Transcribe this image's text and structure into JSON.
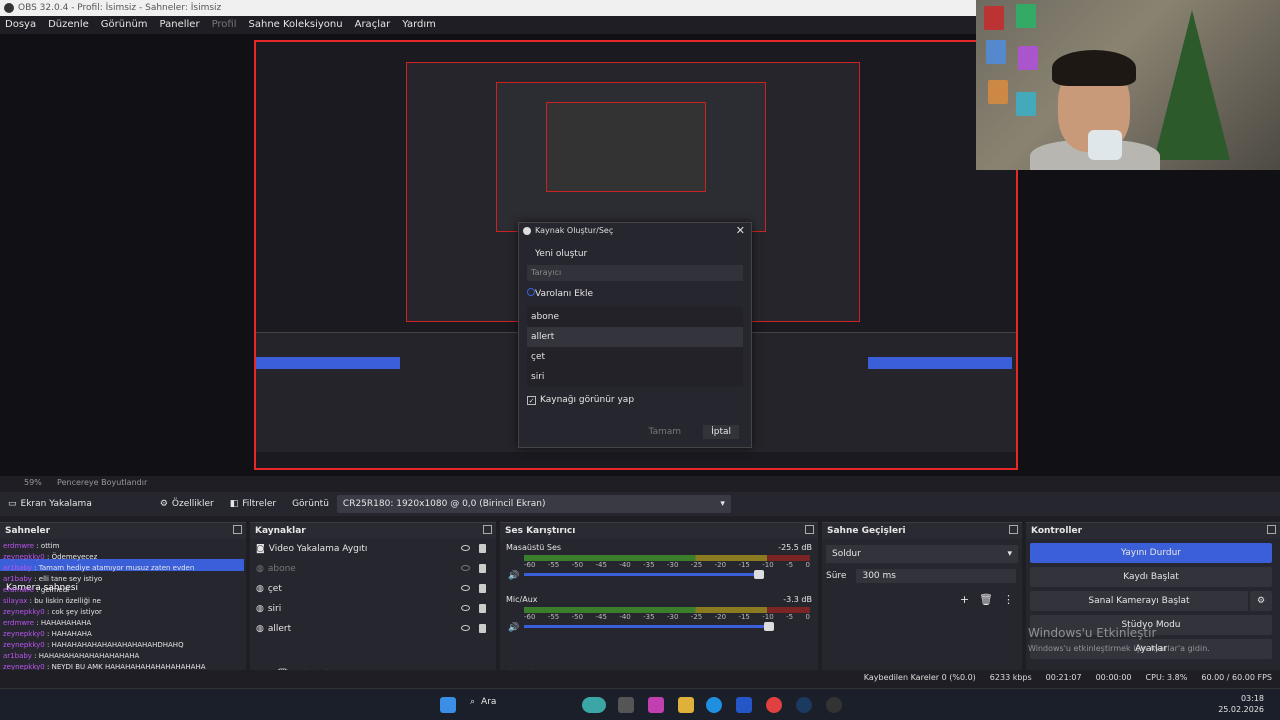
{
  "window": {
    "title": "OBS 32.0.4 - Profil: İsimsiz - Sahneler: İsimsiz"
  },
  "menu": [
    "Dosya",
    "Düzenle",
    "Görünüm",
    "Paneller",
    "Profil",
    "Sahne Koleksiyonu",
    "Araçlar",
    "Yardım"
  ],
  "zoom": {
    "value": "59%",
    "label": "Pencereye Boyutlandır"
  },
  "source_toolbar": {
    "source": "Ekran Yakalama",
    "properties": "Özellikler",
    "filters": "Filtreler",
    "display_label": "Görüntü",
    "display_value": "CR25R180: 1920x1080 @ 0,0 (Birincil Ekran)"
  },
  "dialog": {
    "title": "Kaynak Oluştur/Seç",
    "create_new": "Yeni oluştur",
    "name_placeholder": "Tarayıcı",
    "add_existing": "Varolanı Ekle",
    "existing": [
      "abone",
      "allert",
      "çet",
      "siri"
    ],
    "visible_label": "Kaynağı görünür yap",
    "ok": "Tamam",
    "cancel": "İptal"
  },
  "scenes": {
    "title": "Sahneler",
    "overlay_label": "Kamera sahnesi",
    "chat": [
      {
        "user": "erdmwre",
        "msg": "ottim"
      },
      {
        "user": "zeynepkky0",
        "msg": "Ödemeyecez"
      },
      {
        "user": "ar1baby",
        "msg": "Tamam hediye atamıyor musuz zaten evden"
      },
      {
        "user": "ar1baby",
        "msg": "elli tane sey istiyo"
      },
      {
        "user": "erdmwre",
        "msg": "gelmedi"
      },
      {
        "user": "silayax",
        "msg": "bu liskin özelliği ne"
      },
      {
        "user": "zeynepkky0",
        "msg": "cok şey istiyor"
      },
      {
        "user": "erdmwre",
        "msg": "HAHAHAHAHA"
      },
      {
        "user": "zeynepkky0",
        "msg": "HAHAHAHA"
      },
      {
        "user": "zeynepkky0",
        "msg": "HAHAHAHAHAHAHAHAHAHAHDHAHQ"
      },
      {
        "user": "ar1baby",
        "msg": "HAHAHAHAHAHAHAHAHAHA"
      },
      {
        "user": "zeynepkky0",
        "msg": "NEYDI BU AMK HAHAHAHAHAHAHAHAHAHA"
      }
    ]
  },
  "sources": {
    "title": "Kaynaklar",
    "items": [
      "Video Yakalama Aygıtı",
      "abone",
      "çet",
      "siri",
      "allert"
    ]
  },
  "mixer": {
    "title": "Ses Karıştırıcı",
    "channels": [
      {
        "name": "Masaüstü Ses",
        "db": "-25.5 dB"
      },
      {
        "name": "Mic/Aux",
        "db": "-3.3 dB"
      }
    ],
    "scale": [
      "-60",
      "-55",
      "-50",
      "-45",
      "-40",
      "-35",
      "-30",
      "-25",
      "-20",
      "-15",
      "-10",
      "-5",
      "0"
    ]
  },
  "transitions": {
    "title": "Sahne Geçişleri",
    "type": "Soldur",
    "duration_label": "Süre",
    "duration": "300 ms"
  },
  "controls": {
    "title": "Kontroller",
    "stream": "Yayını Durdur",
    "record": "Kaydı Başlat",
    "virtualcam": "Sanal Kamerayı Başlat",
    "studio": "Stüdyo Modu",
    "settings": "Ayarlar"
  },
  "watermark": {
    "line1": "Windows'u Etkinleştir",
    "line2": "Windows'u etkinleştirmek için Ayarlar'a gidin."
  },
  "status": {
    "dropped": "Kaybedilen Kareler 0 (%0.0)",
    "bitrate": "6233 kbps",
    "stream_time": "00:21:07",
    "rec_time": "00:00:00",
    "cpu": "CPU: 3.8%",
    "fps": "60.00 / 60.00 FPS"
  },
  "taskbar": {
    "search": "Ara",
    "time": "03:18",
    "date": "25.02.2026"
  },
  "colors": {
    "accent": "#3b5fd9",
    "preview_border": "#e62828",
    "bg": "#1e1e24",
    "panel": "#26262e"
  }
}
